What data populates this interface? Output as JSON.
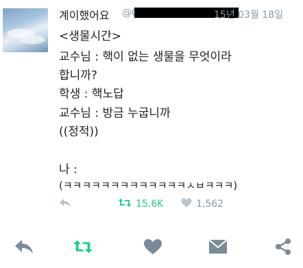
{
  "tweet": {
    "author_name": "계이했어요",
    "handle_visible": "@C",
    "date": "15년 03월 18일",
    "lines": [
      "<생물시간>",
      "교수님 : 핵이 없는 생물을 무엇이라",
      "합니까?",
      "학생 : 핵노답",
      "교수님 : 방금 누굽니까",
      "((정적))",
      "",
      "나 :",
      "(ㅋㅋㅋㅋㅋㅋㅋㅋㅋㅋㅋㅋㅋㅅㅂㅋㅋㅋ)"
    ],
    "retweets": "15.6K",
    "likes": "1,562"
  },
  "colors": {
    "retweet_green": "#19cf86",
    "muted": "#8899a6",
    "bottom_icons": "#7a8a99"
  },
  "icons": {
    "reply": "reply-icon",
    "retweet": "retweet-icon",
    "like": "heart-icon",
    "message": "envelope-icon",
    "share": "share-icon"
  }
}
